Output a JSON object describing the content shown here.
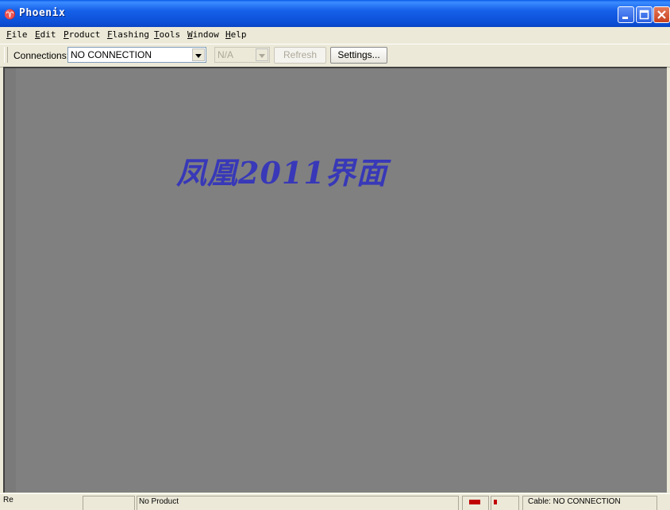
{
  "window": {
    "title": "Phoenix",
    "icon": "phoenix-app-icon"
  },
  "menu": {
    "items": [
      {
        "accel": "F",
        "rest": "ile"
      },
      {
        "accel": "E",
        "rest": "dit"
      },
      {
        "accel": "P",
        "rest": "roduct"
      },
      {
        "accel": "F",
        "rest": "lashing"
      },
      {
        "accel": "T",
        "rest": "ools"
      },
      {
        "accel": "W",
        "rest": "indow"
      },
      {
        "accel": "H",
        "rest": "elp"
      }
    ]
  },
  "toolbar": {
    "connections_label": "Connections:",
    "connection_value": "NO CONNECTION",
    "product_value": "N/A",
    "refresh_label": "Refresh",
    "settings_label": "Settings..."
  },
  "workspace": {
    "overlay_text": "凤凰2011界面",
    "overlay_color": "#3838b8",
    "background_color": "#808080"
  },
  "statusbar": {
    "left_text": "Re",
    "mid_text": "No Product",
    "right_text": "Cable: NO CONNECTION",
    "indicator_color": "#c00000"
  }
}
